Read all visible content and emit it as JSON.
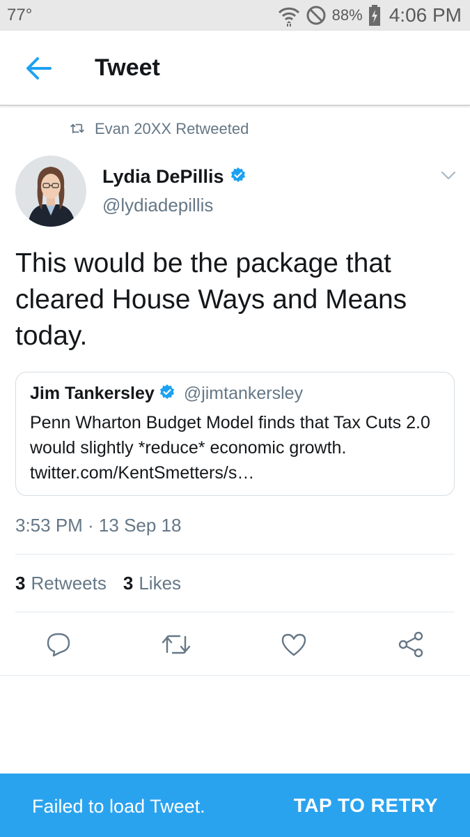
{
  "status_bar": {
    "temperature": "77°",
    "battery_percent": "88%",
    "time": "4:06 PM"
  },
  "toolbar": {
    "title": "Tweet",
    "back_icon": "arrow-left-icon"
  },
  "retweet_context": {
    "label": "Evan 20XX Retweeted",
    "icon": "retweet-icon"
  },
  "author": {
    "name": "Lydia DePillis",
    "handle": "@lydiadepillis",
    "verified": true
  },
  "tweet": {
    "text": "This would be the package that cleared House Ways and Means today.",
    "timestamp": "3:53 PM · 13 Sep 18"
  },
  "quoted_tweet": {
    "name": "Jim Tankersley",
    "handle": "@jimtankersley",
    "verified": true,
    "text": "Penn Wharton Budget Model finds that Tax Cuts 2.0 would slightly *reduce* economic growth. twitter.com/KentSmetters/s…"
  },
  "stats": {
    "retweets_count": "3",
    "retweets_label": "Retweets",
    "likes_count": "3",
    "likes_label": "Likes"
  },
  "actions": [
    "reply-icon",
    "retweet-icon",
    "like-icon",
    "share-icon"
  ],
  "snackbar": {
    "message": "Failed to load Tweet.",
    "action": "TAP TO RETRY"
  },
  "colors": {
    "accent": "#1da1f2",
    "snackbar_bg": "#2aa3ef",
    "secondary_text": "#657786",
    "primary_text": "#14171a"
  }
}
